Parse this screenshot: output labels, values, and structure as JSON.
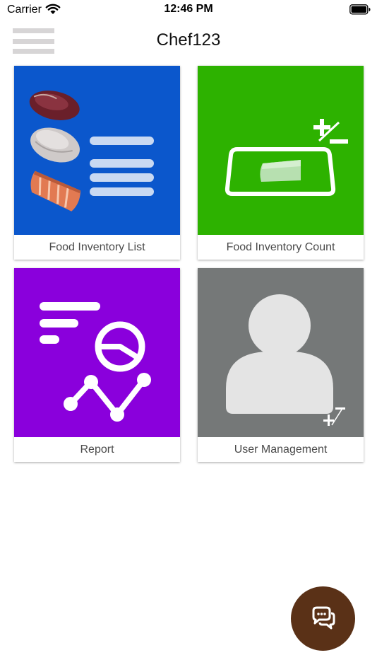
{
  "status_bar": {
    "carrier": "Carrier",
    "time": "12:46 PM",
    "wifi_icon": "wifi-icon",
    "battery_icon": "battery-full-icon"
  },
  "header": {
    "title": "Chef123",
    "menu_icon": "hamburger-menu-icon"
  },
  "tiles": [
    {
      "label": "Food Inventory List",
      "color": "#0b57cc",
      "icon": "food-list-icon"
    },
    {
      "label": "Food Inventory Count",
      "color": "#2db200",
      "icon": "inventory-count-icon"
    },
    {
      "label": "Report",
      "color": "#8a00dc",
      "icon": "report-chart-icon"
    },
    {
      "label": "User Management",
      "color": "#757878",
      "icon": "user-management-icon"
    }
  ],
  "chat_button": {
    "icon": "chat-bubbles-icon",
    "color": "#5a3117"
  }
}
